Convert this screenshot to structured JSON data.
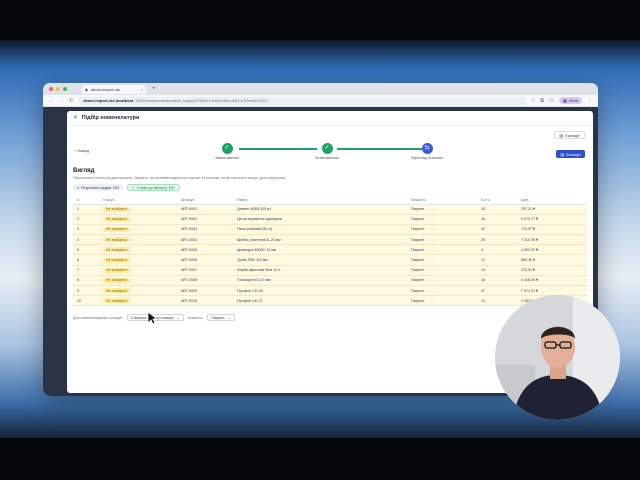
{
  "browser": {
    "tab_title": "demo-import-xls",
    "url_host": "demo-import-xls.localhost",
    "url_path": ":3000/documents/demand_supply/97f40fe1-fb0a-4f6e-ab02-b7f0eb5c7037c",
    "profile_label": "Work",
    "new_tab_glyph": "+",
    "tab_close_glyph": "×"
  },
  "modal": {
    "title": "Підбір номенклатури",
    "close_glyph": "✕",
    "export_top_label": "Експорт",
    "back_label": "Назад",
    "export_primary_label": "Експорт"
  },
  "stepper": {
    "steps": [
      {
        "label": "Завантаження",
        "state": "done",
        "glyph": "✓"
      },
      {
        "label": "Встановлення",
        "state": "done",
        "glyph": "✓"
      },
      {
        "label": "Перегляд та імпорт",
        "state": "active",
        "glyph": "⇆"
      }
    ]
  },
  "section": {
    "title": "Вигляд",
    "subtitle": "Перегляньте остаточні дані імпорту. Зверніть, як перейменовується сторінки та колонки, потім натисніть імпорт для розрахунку",
    "chip_rows": "Результати рядків: 100",
    "chip_ready": "Готово до імпорту: 100"
  },
  "table": {
    "headers": [
      "#",
      "Статус",
      "Артикул",
      "Назва",
      "Кількість",
      "К-сть",
      "Ціна"
    ],
    "rows": [
      {
        "n": "1",
        "status": "Не знайдено",
        "sku": "ART-0001",
        "name": "Цемент М500 (25 кг)",
        "qty_type": "Пакуєте",
        "qty": "15",
        "price": "797,21 ₴"
      },
      {
        "n": "2",
        "status": "Не знайдено",
        "sku": "ART-0002",
        "name": "Цегла керамічна одинарна",
        "qty_type": "Пакуєте",
        "qty": "16",
        "price": "2 572,77 ₴"
      },
      {
        "n": "3",
        "status": "Не знайдено",
        "sku": "ART-0003",
        "name": "Пісок річковий (50 кг)",
        "qty_type": "Пакуєте",
        "qty": "42",
        "price": "714,97 ₴"
      },
      {
        "n": "4",
        "status": "Не знайдено",
        "sku": "ART-0004",
        "name": "Щебінь гранітний 5–20 мм",
        "qty_type": "Пакуєте",
        "qty": "29",
        "price": "7 410,90 ₴"
      },
      {
        "n": "5",
        "status": "Не знайдено",
        "sku": "ART-0005",
        "name": "Арматура А500С 12 мм",
        "qty_type": "Пакуєте",
        "qty": "4",
        "price": "4 803,37 ₴"
      },
      {
        "n": "6",
        "status": "Не знайдено",
        "sku": "ART-0006",
        "name": "Труба ПВХ 110 мм",
        "qty_type": "Пакуєте",
        "qty": "12",
        "price": "883,40 ₴"
      },
      {
        "n": "7",
        "status": "Не знайдено",
        "sku": "ART-0007",
        "name": "Фарба акрилова біла 10 л",
        "qty_type": "Пакуєте",
        "qty": "13",
        "price": "723,51 ₴"
      },
      {
        "n": "8",
        "status": "Не знайдено",
        "sku": "ART-0008",
        "name": "Гіпсокартон 12.5 мм",
        "qty_type": "Пакуєте",
        "qty": "16",
        "price": "4 418,00 ₴"
      },
      {
        "n": "9",
        "status": "Не знайдено",
        "sku": "ART-0009",
        "name": "Профіль CD-60",
        "qty_type": "Пакуєте",
        "qty": "47",
        "price": "7 571,01 ₴"
      },
      {
        "n": "10",
        "status": "Не знайдено",
        "sku": "ART-0010",
        "name": "Профіль UD-27",
        "qty_type": "Пакуєте",
        "qty": "12",
        "price": "1 263,07 ₴"
      }
    ]
  },
  "footer": {
    "label": "Для нових/невідомих позицій:",
    "select1": "Створити як нову позицію",
    "label2": "Кількість:",
    "select2": "Пакуєте"
  },
  "colors": {
    "primary": "#2f4fc9",
    "success": "#22a06b",
    "warning_bg": "#fff9e0",
    "status_badge": "#fdeca0"
  }
}
